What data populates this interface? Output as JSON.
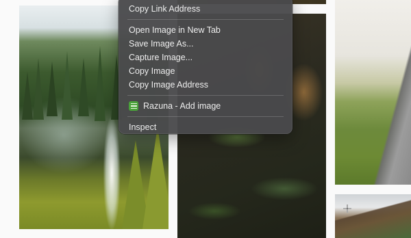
{
  "context_menu": {
    "items": [
      {
        "label": "Copy Link Address"
      },
      {
        "label": "Open Image in New Tab"
      },
      {
        "label": "Save Image As..."
      },
      {
        "label": "Capture Image..."
      },
      {
        "label": "Copy Image"
      },
      {
        "label": "Copy Image Address"
      },
      {
        "label": "Razuna - Add image",
        "icon": "razuna-extension-icon"
      },
      {
        "label": "Inspect"
      }
    ]
  },
  "gallery": {
    "images": [
      {
        "subject": "waterfall-forest"
      },
      {
        "subject": "leaves-closeup"
      },
      {
        "subject": "forest-boardwalk"
      },
      {
        "subject": "mountain-valley"
      }
    ]
  },
  "colors": {
    "menu_bg": "#4a4a4c",
    "menu_text": "#eeeeee",
    "extension_icon": "#4aa33a",
    "page_bg": "#fafafa"
  }
}
